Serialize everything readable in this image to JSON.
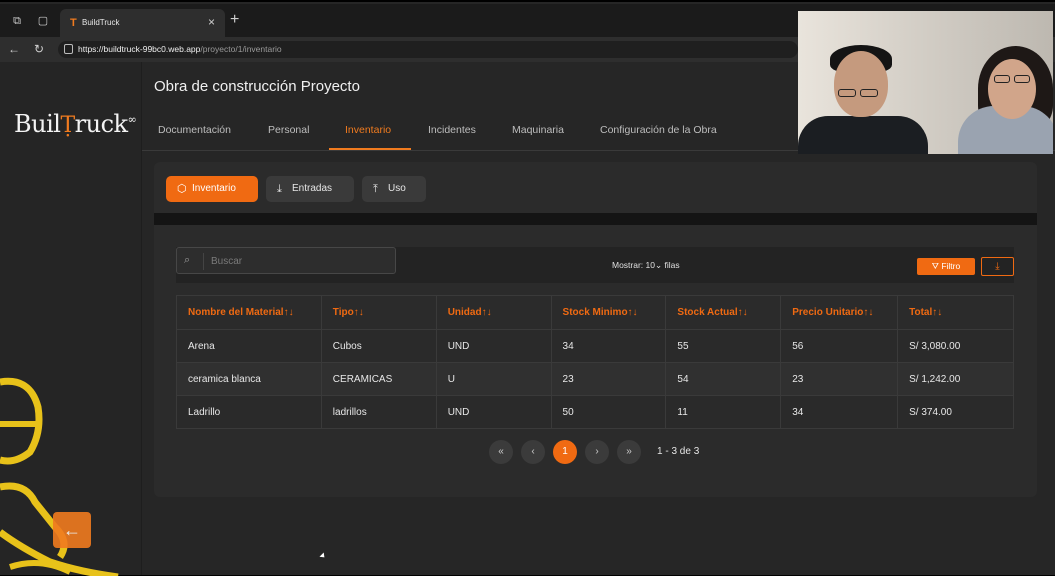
{
  "browser": {
    "tab_title": "BuildTruck",
    "url_host": "https://buildtruck-99bc0.web.app",
    "url_path": "/proyecto/1/inventario"
  },
  "sidebar": {
    "logo_text": "Buil",
    "logo_text2": "ruck",
    "back_icon": "arrow-left-icon"
  },
  "header": {
    "project_title": "Obra de construcción Proyecto"
  },
  "tabs": [
    {
      "label": "Documentación"
    },
    {
      "label": "Personal"
    },
    {
      "label": "Inventario",
      "active": true
    },
    {
      "label": "Incidentes"
    },
    {
      "label": "Maquinaria"
    },
    {
      "label": "Configuración de la Obra"
    }
  ],
  "subtabs": [
    {
      "label": "Inventario",
      "icon": "box-icon",
      "active": true
    },
    {
      "label": "Entradas",
      "icon": "download-icon"
    },
    {
      "label": "Uso",
      "icon": "upload-icon"
    }
  ],
  "toolbar": {
    "search_placeholder": "Buscar",
    "show_label": "Mostrar:",
    "show_value": "10",
    "show_suffix": "filas",
    "filter_label": "Filtro"
  },
  "table": {
    "columns": [
      "Nombre del Material↑↓",
      "Tipo↑↓",
      "Unidad↑↓",
      "Stock Minimo↑↓",
      "Stock Actual↑↓",
      "Precio Unitario↑↓",
      "Total↑↓"
    ],
    "rows": [
      [
        "Arena",
        "Cubos",
        "UND",
        "34",
        "55",
        "56",
        "S/ 3,080.00"
      ],
      [
        "ceramica blanca",
        "CERAMICAS",
        "U",
        "23",
        "54",
        "23",
        "S/ 1,242.00"
      ],
      [
        "Ladrillo",
        "ladrillos",
        "UND",
        "50",
        "11",
        "34",
        "S/ 374.00"
      ]
    ]
  },
  "pagination": {
    "first": "«",
    "prev": "‹",
    "current": "1",
    "next": "›",
    "last": "»",
    "info": "1 - 3 de 3"
  },
  "colors": {
    "accent": "#f06a12",
    "background": "#262626"
  }
}
